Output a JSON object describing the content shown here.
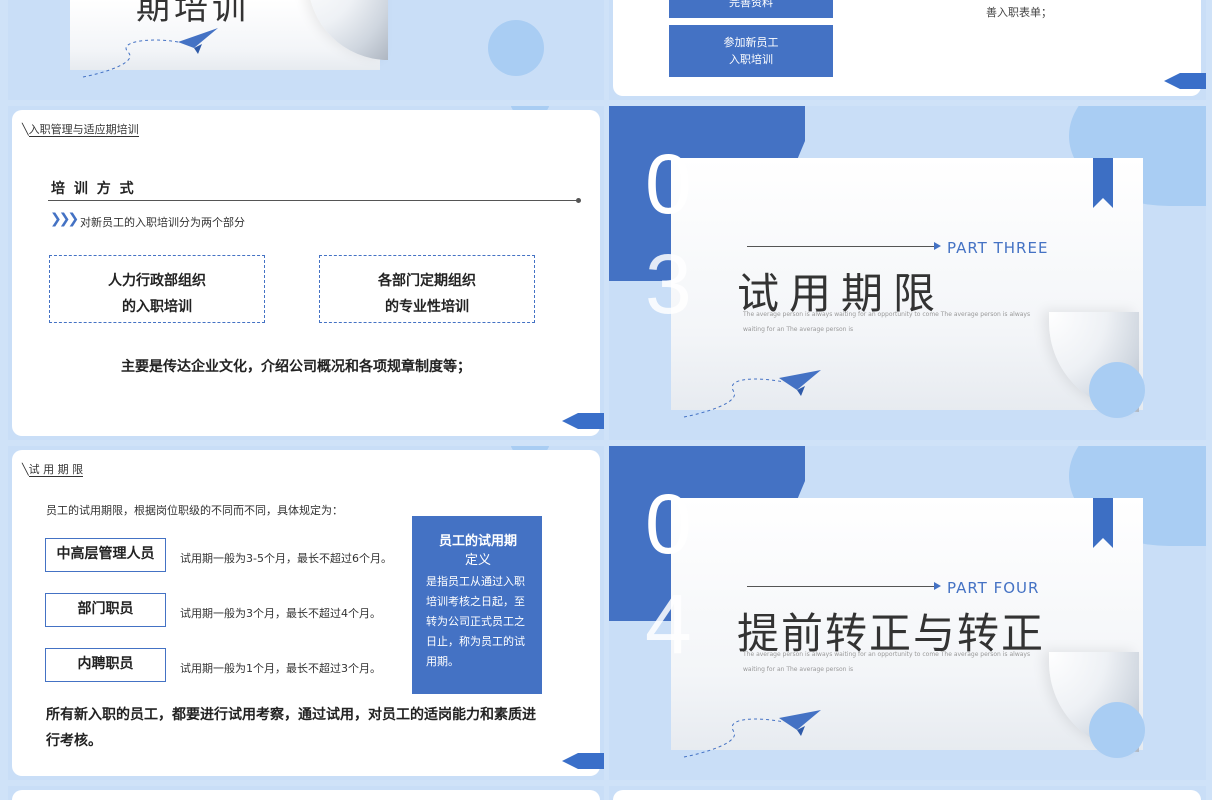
{
  "colors": {
    "accent": "#4472c4",
    "light_blue": "#c9def7",
    "text_dark": "#333333"
  },
  "slide_top_left": {
    "title_partial": "期培训",
    "icon": "paper-plane-icon"
  },
  "slide_top_right": {
    "button_1": "完善资料",
    "button_2_line1": "参加新员工",
    "button_2_line2": "入职培训",
    "note": "善入职表单；"
  },
  "slide_training": {
    "section_title": "入职管理与适应期培训",
    "heading": "培 训 方 式",
    "subtitle": "对新员工的入职培训分为两个部分",
    "box1_line1": "人力行政部组织",
    "box1_line2": "的入职培训",
    "box2_line1": "各部门定期组织",
    "box2_line2": "的专业性培训",
    "summary": "主要是传达企业文化，介绍公司概况和各项规章制度等；"
  },
  "slide_part3": {
    "digit1": "0",
    "digit2": "3",
    "part_label": "PART THREE",
    "title": "试用期限",
    "desc_line1": "The average person is always waiting for an opportunity to come The average person is always",
    "desc_line2": "waiting for an The average person is"
  },
  "slide_probation": {
    "section_title": "试 用 期 限",
    "intro": "员工的试用期限，根据岗位职级的不同而不同，具体规定为：",
    "rows": [
      {
        "role": "中高层管理人员",
        "rule": "试用期一般为3-5个月，最长不超过6个月。"
      },
      {
        "role": "部门职员",
        "rule": "试用期一般为3个月，最长不超过4个月。"
      },
      {
        "role": "内聘职员",
        "rule": "试用期一般为1个月，最长不超过3个月。"
      }
    ],
    "def_title_line1": "员工的试用期",
    "def_title_line2": "定义",
    "def_body": "是指员工从通过入职培训考核之日起，至转为公司正式员工之日止，称为员工的试用期。",
    "summary": "所有新入职的员工，都要进行试用考察，通过试用，对员工的适岗能力和素质进行考核。"
  },
  "slide_part4": {
    "digit1": "0",
    "digit2": "4",
    "part_label": "PART FOUR",
    "title": "提前转正与转正",
    "desc_line1": "The average person is always waiting for an opportunity to come The average person is always",
    "desc_line2": "waiting for an The average person is"
  }
}
